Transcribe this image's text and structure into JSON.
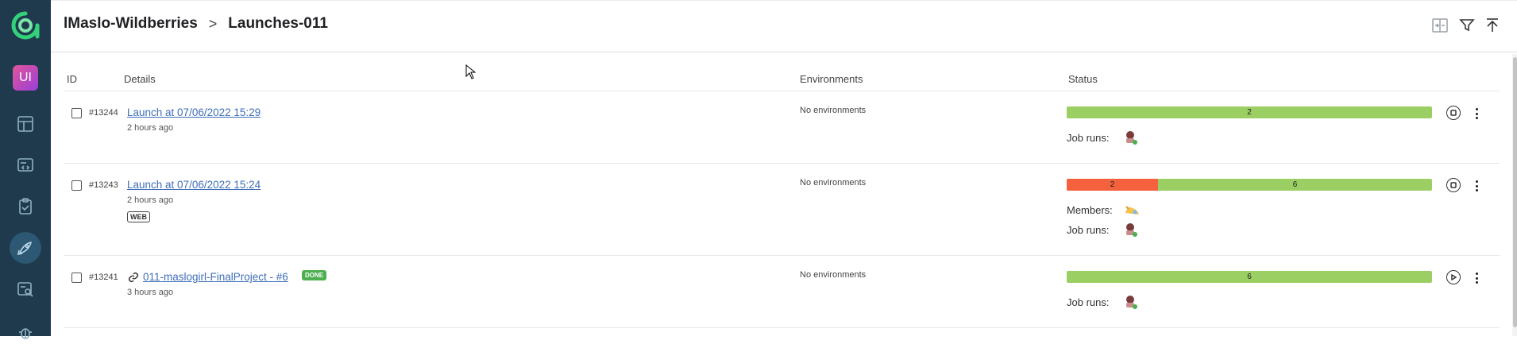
{
  "project": {
    "avatar_text": "UI"
  },
  "sidebar": {
    "items": [
      {
        "icon": "dashboard-icon"
      },
      {
        "icon": "test-cases-icon"
      },
      {
        "icon": "test-plans-icon"
      },
      {
        "icon": "launches-icon",
        "active": true
      },
      {
        "icon": "analytics-icon"
      },
      {
        "icon": "defects-icon"
      }
    ]
  },
  "header": {
    "breadcrumb_project": "lMaslo-Wildberries",
    "breadcrumb_separator": ">",
    "breadcrumb_page": "Launches-011"
  },
  "table": {
    "columns": {
      "id": "ID",
      "details": "Details",
      "environments": "Environments",
      "status": "Status"
    },
    "rows": [
      {
        "id": "#13244",
        "title": "Launch at 07/06/2022 15:29",
        "time": "2 hours ago",
        "tag": "",
        "environments": "No environments",
        "status": {
          "passed": 2,
          "failed": 0
        },
        "passed_label": "2",
        "failed_label": "",
        "members_label": "",
        "job_runs_label": "Job runs:",
        "action": "stop"
      },
      {
        "id": "#13243",
        "title": "Launch at 07/06/2022 15:24",
        "time": "2 hours ago",
        "tag": "WEB",
        "environments": "No environments",
        "status": {
          "passed": 6,
          "failed": 2
        },
        "passed_label": "6",
        "failed_label": "2",
        "members_label": "Members:",
        "job_runs_label": "Job runs:",
        "action": "stop"
      },
      {
        "id": "#13241",
        "title": "011-maslogirl-FinalProject - #6",
        "time": "3 hours ago",
        "tag": "DONE",
        "environments": "No environments",
        "status": {
          "passed": 6,
          "failed": 0
        },
        "passed_label": "6",
        "failed_label": "",
        "members_label": "",
        "job_runs_label": "Job runs:",
        "action": "play"
      }
    ]
  },
  "colors": {
    "sidebar_bg": "#1f3a4c",
    "passed": "#9ccf63",
    "failed": "#f5603d",
    "link": "#3f6eb8",
    "done_badge": "#4caf50"
  }
}
